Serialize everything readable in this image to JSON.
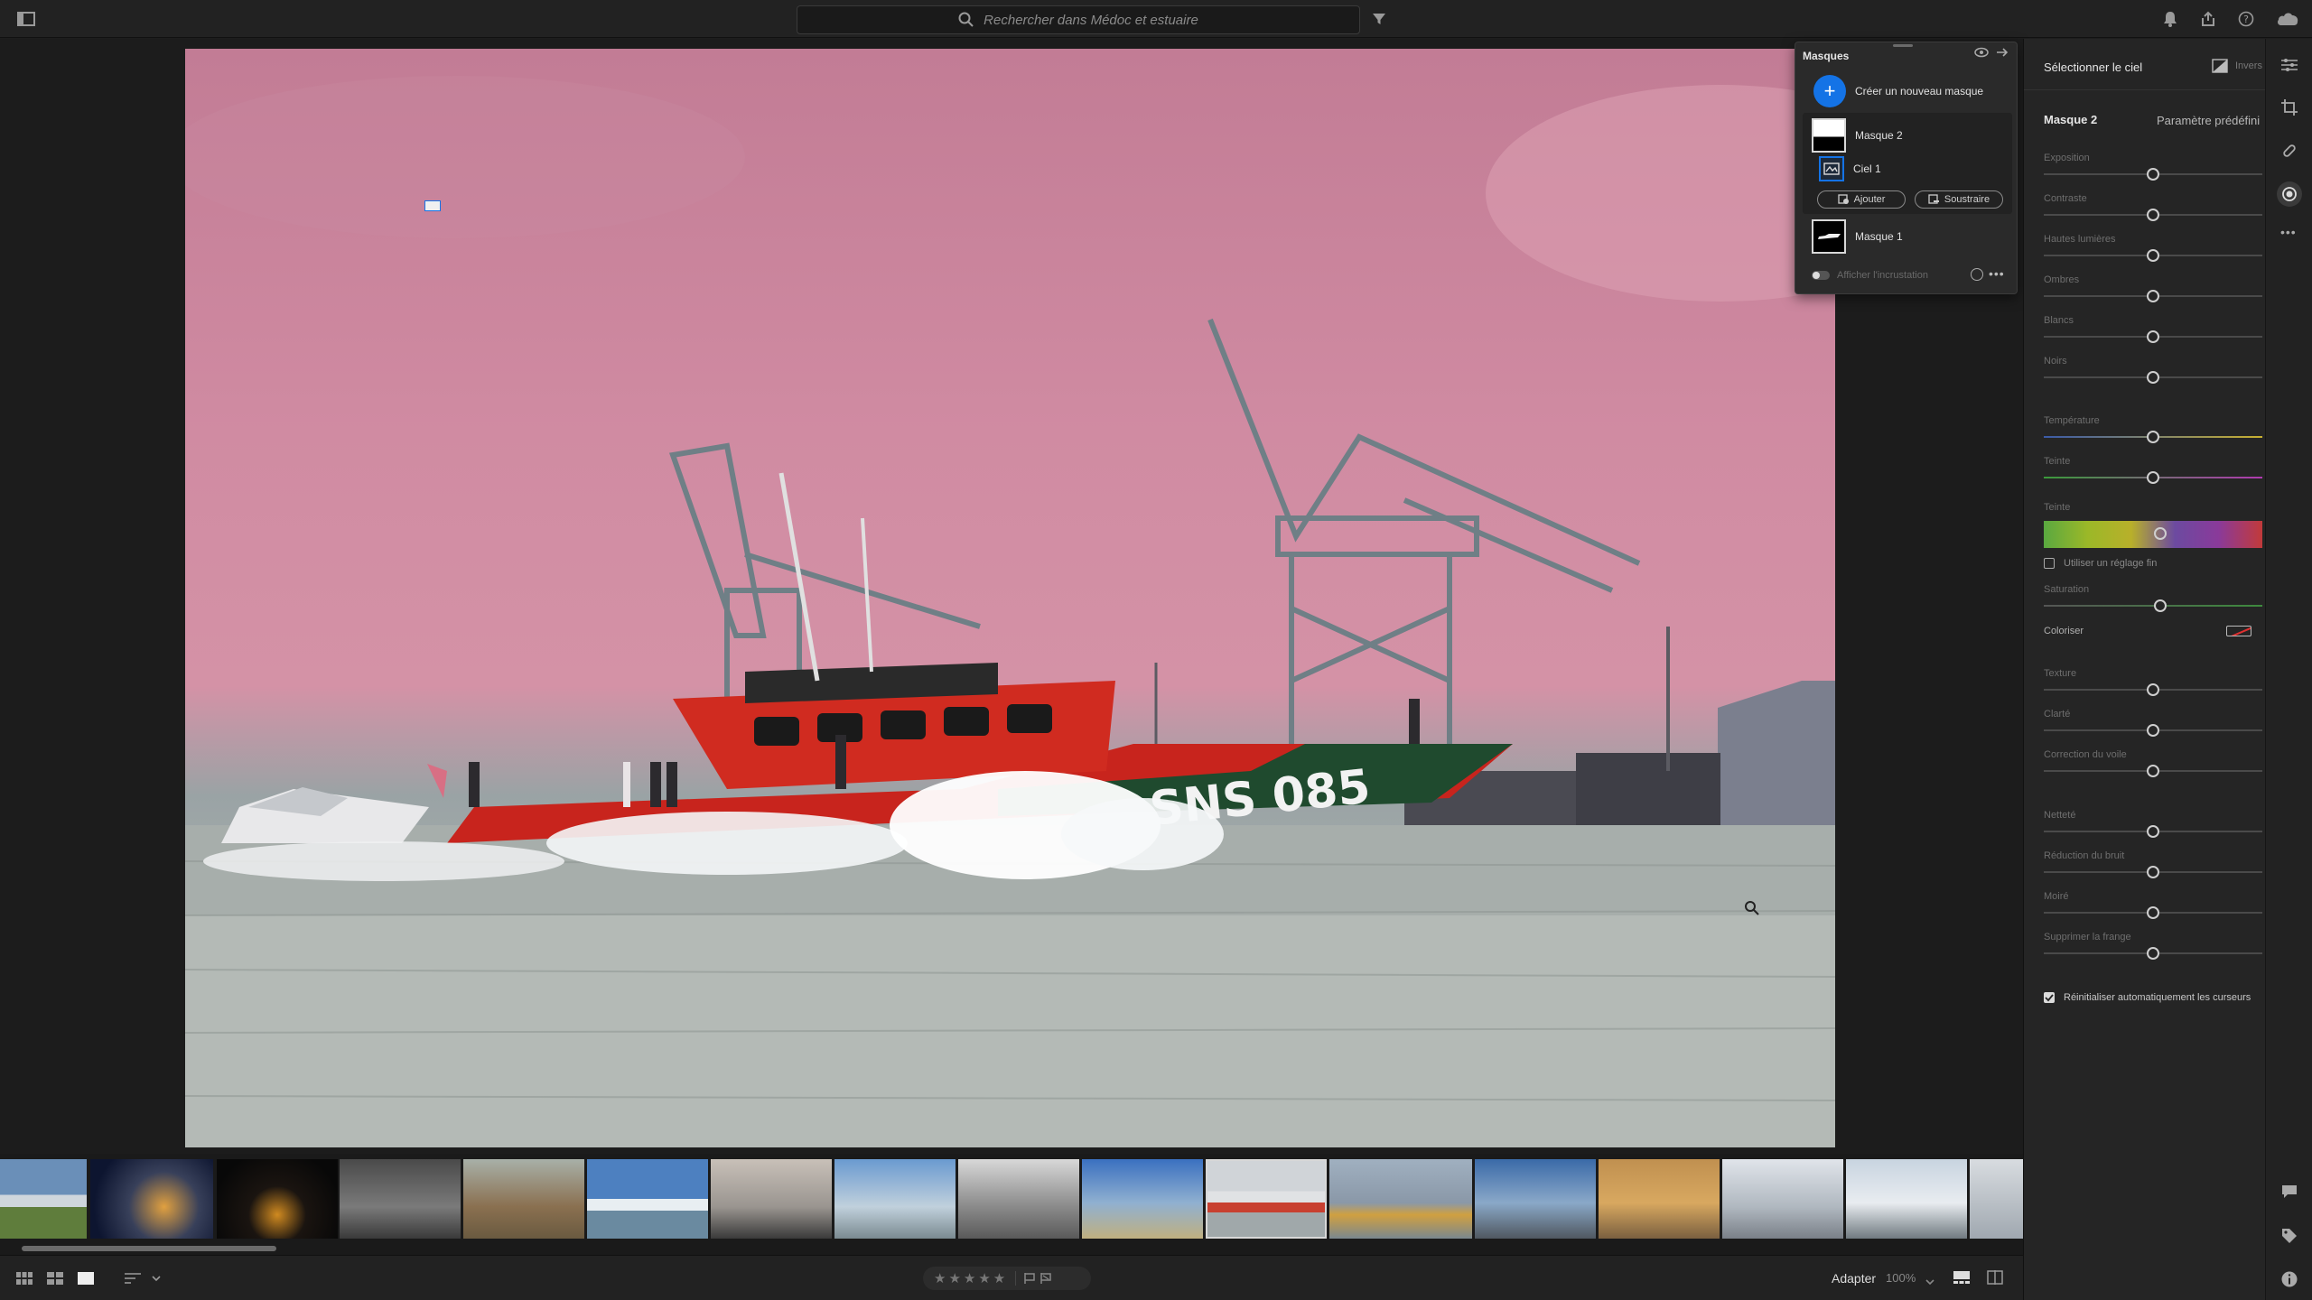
{
  "search": {
    "placeholder": "Rechercher dans Médoc et estuaire"
  },
  "masks_panel": {
    "title": "Masques",
    "create_label": "Créer un nouveau masque",
    "masks": [
      {
        "name": "Masque 2",
        "components": [
          {
            "name": "Ciel 1"
          }
        ]
      },
      {
        "name": "Masque 1"
      }
    ],
    "add_label": "Ajouter",
    "subtract_label": "Soustraire",
    "overlay_label": "Afficher l'incrustation"
  },
  "right_panel": {
    "header_title": "Sélectionner le ciel",
    "invert_label": "Invers",
    "mask_name": "Masque 2",
    "preset_label": "Paramètre prédéfini",
    "sliders": [
      {
        "label": "Exposition",
        "value": 0
      },
      {
        "label": "Contraste",
        "value": 0
      },
      {
        "label": "Hautes lumières",
        "value": 0
      },
      {
        "label": "Ombres",
        "value": 0
      },
      {
        "label": "Blancs",
        "value": 0
      },
      {
        "label": "Noirs",
        "value": 0
      },
      {
        "label": "Température",
        "value": 0
      },
      {
        "label": "Teinte",
        "value": 0
      }
    ],
    "hue_label": "Teinte",
    "fine_adjust_label": "Utiliser un réglage fin",
    "saturation_label": "Saturation",
    "colorize_label": "Coloriser",
    "sliders2": [
      {
        "label": "Texture",
        "value": 0
      },
      {
        "label": "Clarté",
        "value": 0
      },
      {
        "label": "Correction du voile",
        "value": 0
      }
    ],
    "sliders3": [
      {
        "label": "Netteté",
        "value": 0
      },
      {
        "label": "Réduction du bruit",
        "value": 0
      },
      {
        "label": "Moiré",
        "value": 0
      },
      {
        "label": "Supprimer la frange",
        "value": 0
      }
    ],
    "auto_reset_label": "Réinitialiser automatiquement les curseurs"
  },
  "photo": {
    "boat_text": "SNS 085"
  },
  "bottom_bar": {
    "fit_label": "Adapter",
    "zoom_label": "100%"
  },
  "colors": {
    "accent": "#1473e6",
    "sky_tint": "#d08ba2",
    "water": "#a9b0ad"
  }
}
